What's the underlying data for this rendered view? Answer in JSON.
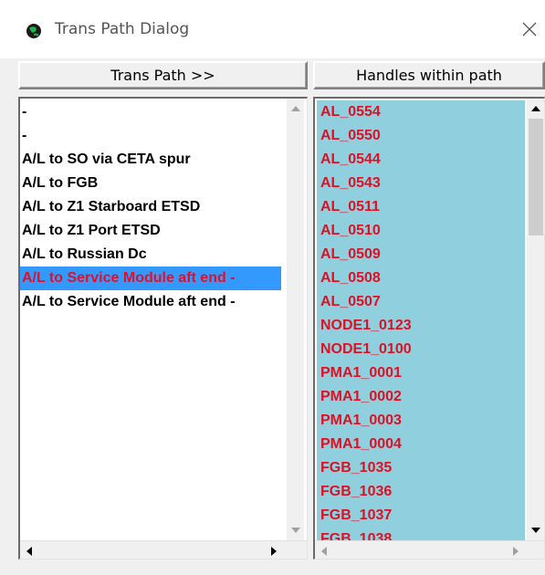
{
  "window": {
    "title": "Trans Path Dialog",
    "close_glyph": "✕"
  },
  "left_panel": {
    "header": "Trans Path >>",
    "items": [
      {
        "label": "-"
      },
      {
        "label": "-"
      },
      {
        "label": "A/L to SO via CETA spur"
      },
      {
        "label": "A/L to FGB"
      },
      {
        "label": "A/L to Z1 Starboard ETSD"
      },
      {
        "label": "A/L to Z1 Port ETSD"
      },
      {
        "label": "A/L to Russian Dc"
      },
      {
        "label": "A/L to Service Module aft end -"
      },
      {
        "label": "A/L to Service Module aft end -"
      }
    ],
    "selected_index": 7
  },
  "right_panel": {
    "header": "Handles within path",
    "items": [
      "AL_0554",
      "AL_0550",
      "AL_0544",
      "AL_0543",
      "AL_0511",
      "AL_0510",
      "AL_0509",
      "AL_0508",
      "AL_0507",
      "NODE1_0123",
      "NODE1_0100",
      "PMA1_0001",
      "PMA1_0002",
      "PMA1_0003",
      "PMA1_0004",
      "FGB_1035",
      "FGB_1036",
      "FGB_1037",
      "FGB_1038"
    ],
    "all_selected": true
  },
  "colors": {
    "selection_blue": "#3399ff",
    "handles_bg": "#8fcfde",
    "highlight_red": "#e01024"
  },
  "icons": {
    "app": "green-globe-icon",
    "close": "close-icon",
    "scroll_up": "arrow-up-icon",
    "scroll_down": "arrow-down-icon",
    "scroll_left": "arrow-left-icon",
    "scroll_right": "arrow-right-icon"
  }
}
